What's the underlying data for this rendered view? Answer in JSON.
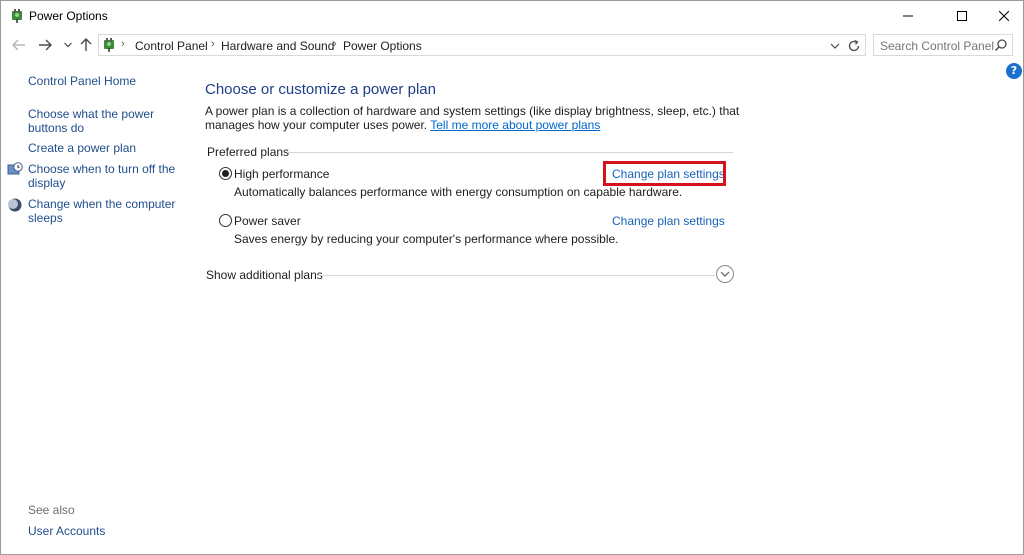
{
  "window": {
    "title": "Power Options"
  },
  "address_bar": {
    "breadcrumbs": [
      "Control Panel",
      "Hardware and Sound",
      "Power Options"
    ]
  },
  "search": {
    "placeholder": "Search Control Panel"
  },
  "left_pane": {
    "home": "Control Panel Home",
    "links": [
      "Choose what the power buttons do",
      "Create a power plan",
      "Choose when to turn off the display",
      "Change when the computer sleeps"
    ],
    "see_also_label": "See also",
    "see_also_links": [
      "User Accounts"
    ]
  },
  "main": {
    "title": "Choose or customize a power plan",
    "description": "A power plan is a collection of hardware and system settings (like display brightness, sleep, etc.) that manages how your computer uses power.",
    "learn_more_link": "Tell me more about power plans",
    "group_label": "Preferred plans",
    "plans": [
      {
        "name": "High performance",
        "description": "Automatically balances performance with energy consumption on capable hardware.",
        "link": "Change plan settings",
        "selected": true
      },
      {
        "name": "Power saver",
        "description": "Saves energy by reducing your computer's performance where possible.",
        "link": "Change plan settings",
        "selected": false
      }
    ],
    "show_additional": "Show additional plans"
  },
  "colors": {
    "link": "#1a63b8",
    "title": "#1e3f87",
    "highlight": "#d4131c",
    "help": "#1a6fcf"
  }
}
